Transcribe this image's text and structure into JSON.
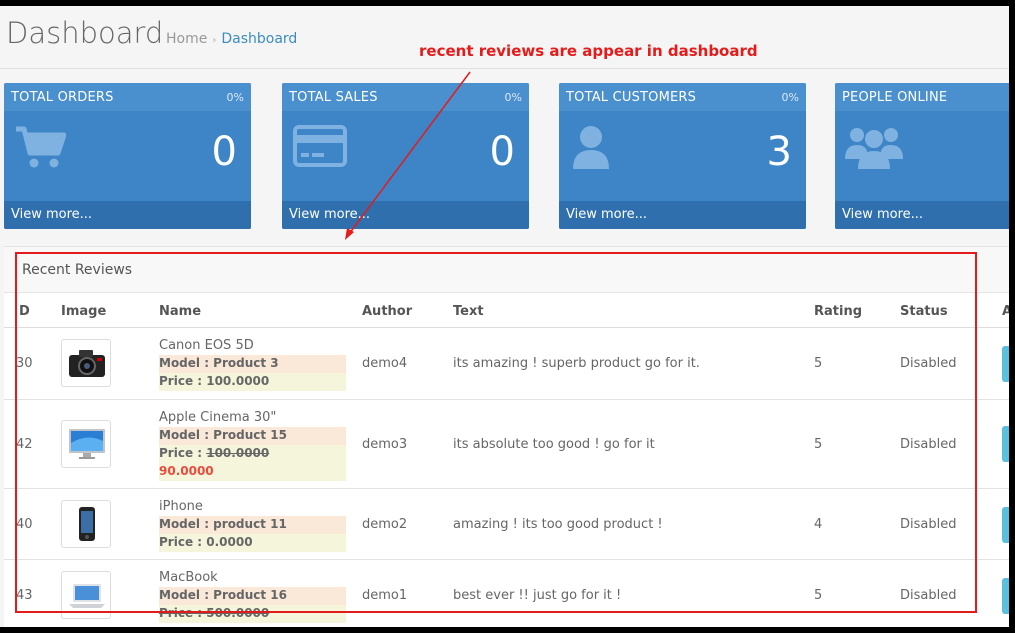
{
  "header": {
    "title": "Dashboard",
    "breadcrumb": [
      "Home",
      "Dashboard"
    ]
  },
  "annotation": "recent reviews are appear in dashboard",
  "tiles": [
    {
      "title": "TOTAL ORDERS",
      "percent": "0%",
      "value": "0",
      "link": "View more...",
      "icon": "shopping-cart-icon"
    },
    {
      "title": "TOTAL SALES",
      "percent": "0%",
      "value": "0",
      "link": "View more...",
      "icon": "credit-card-icon"
    },
    {
      "title": "TOTAL CUSTOMERS",
      "percent": "0%",
      "value": "3",
      "link": "View more...",
      "icon": "user-icon"
    },
    {
      "title": "PEOPLE ONLINE",
      "percent": "",
      "value": "",
      "link": "View more...",
      "icon": "users-icon"
    }
  ],
  "reviews": {
    "title": "Recent Reviews",
    "columns": [
      "D",
      "Image",
      "Name",
      "Author",
      "Text",
      "Rating",
      "Status",
      "A"
    ],
    "rows": [
      {
        "id": "30",
        "image": "camera",
        "name": "Canon EOS 5D",
        "model": "Model : Product 3",
        "price": "Price : 100.0000",
        "old_price": "",
        "special": "",
        "author": "demo4",
        "text": "its amazing ! superb product go for it.",
        "rating": "5",
        "status": "Disabled"
      },
      {
        "id": "42",
        "image": "monitor",
        "name": "Apple Cinema 30\"",
        "model": "Model : Product 15",
        "price": "Price : ",
        "old_price": "100.0000",
        "special": "90.0000",
        "author": "demo3",
        "text": "its absolute too good ! go for it",
        "rating": "5",
        "status": "Disabled"
      },
      {
        "id": "40",
        "image": "phone",
        "name": "iPhone",
        "model": "Model : product 11",
        "price": "Price : 0.0000",
        "old_price": "",
        "special": "",
        "author": "demo2",
        "text": "amazing ! its too good product !",
        "rating": "4",
        "status": "Disabled"
      },
      {
        "id": "43",
        "image": "laptop",
        "name": "MacBook",
        "model": "Model : Product 16",
        "price": "Price : 500.0000",
        "old_price": "",
        "special": "",
        "author": "demo1",
        "text": "best ever !! just go for it !",
        "rating": "5",
        "status": "Disabled"
      }
    ]
  },
  "colors": {
    "tile": "#3d85c6",
    "tile_footer": "#2f6fad",
    "annotation": "#e41b1b",
    "link": "#3c8dbc"
  }
}
